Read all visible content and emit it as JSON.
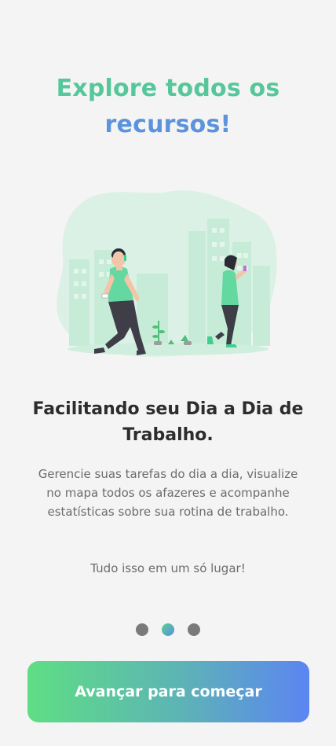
{
  "header": {
    "title_line1": "Explore todos os",
    "title_line2": "recursos!"
  },
  "content": {
    "subtitle": "Facilitando seu Dia a Dia de Trabalho.",
    "description": "Gerencie suas tarefas do dia a dia, visualize no mapa todos os afazeres e acompanhe estatísticas sobre sua rotina de trabalho.",
    "tagline": "Tudo isso em um só lugar!"
  },
  "pagination": {
    "total": 3,
    "active_index": 1
  },
  "cta": {
    "label": "Avançar para começar"
  },
  "colors": {
    "title_green": "#55c79a",
    "title_blue": "#5b93dc",
    "illustration_green": "#6ed8a0",
    "gradient_start": "#5ede84",
    "gradient_end": "#5c85f2"
  },
  "icons": {
    "illustration": "people-walking-city-illustration"
  }
}
